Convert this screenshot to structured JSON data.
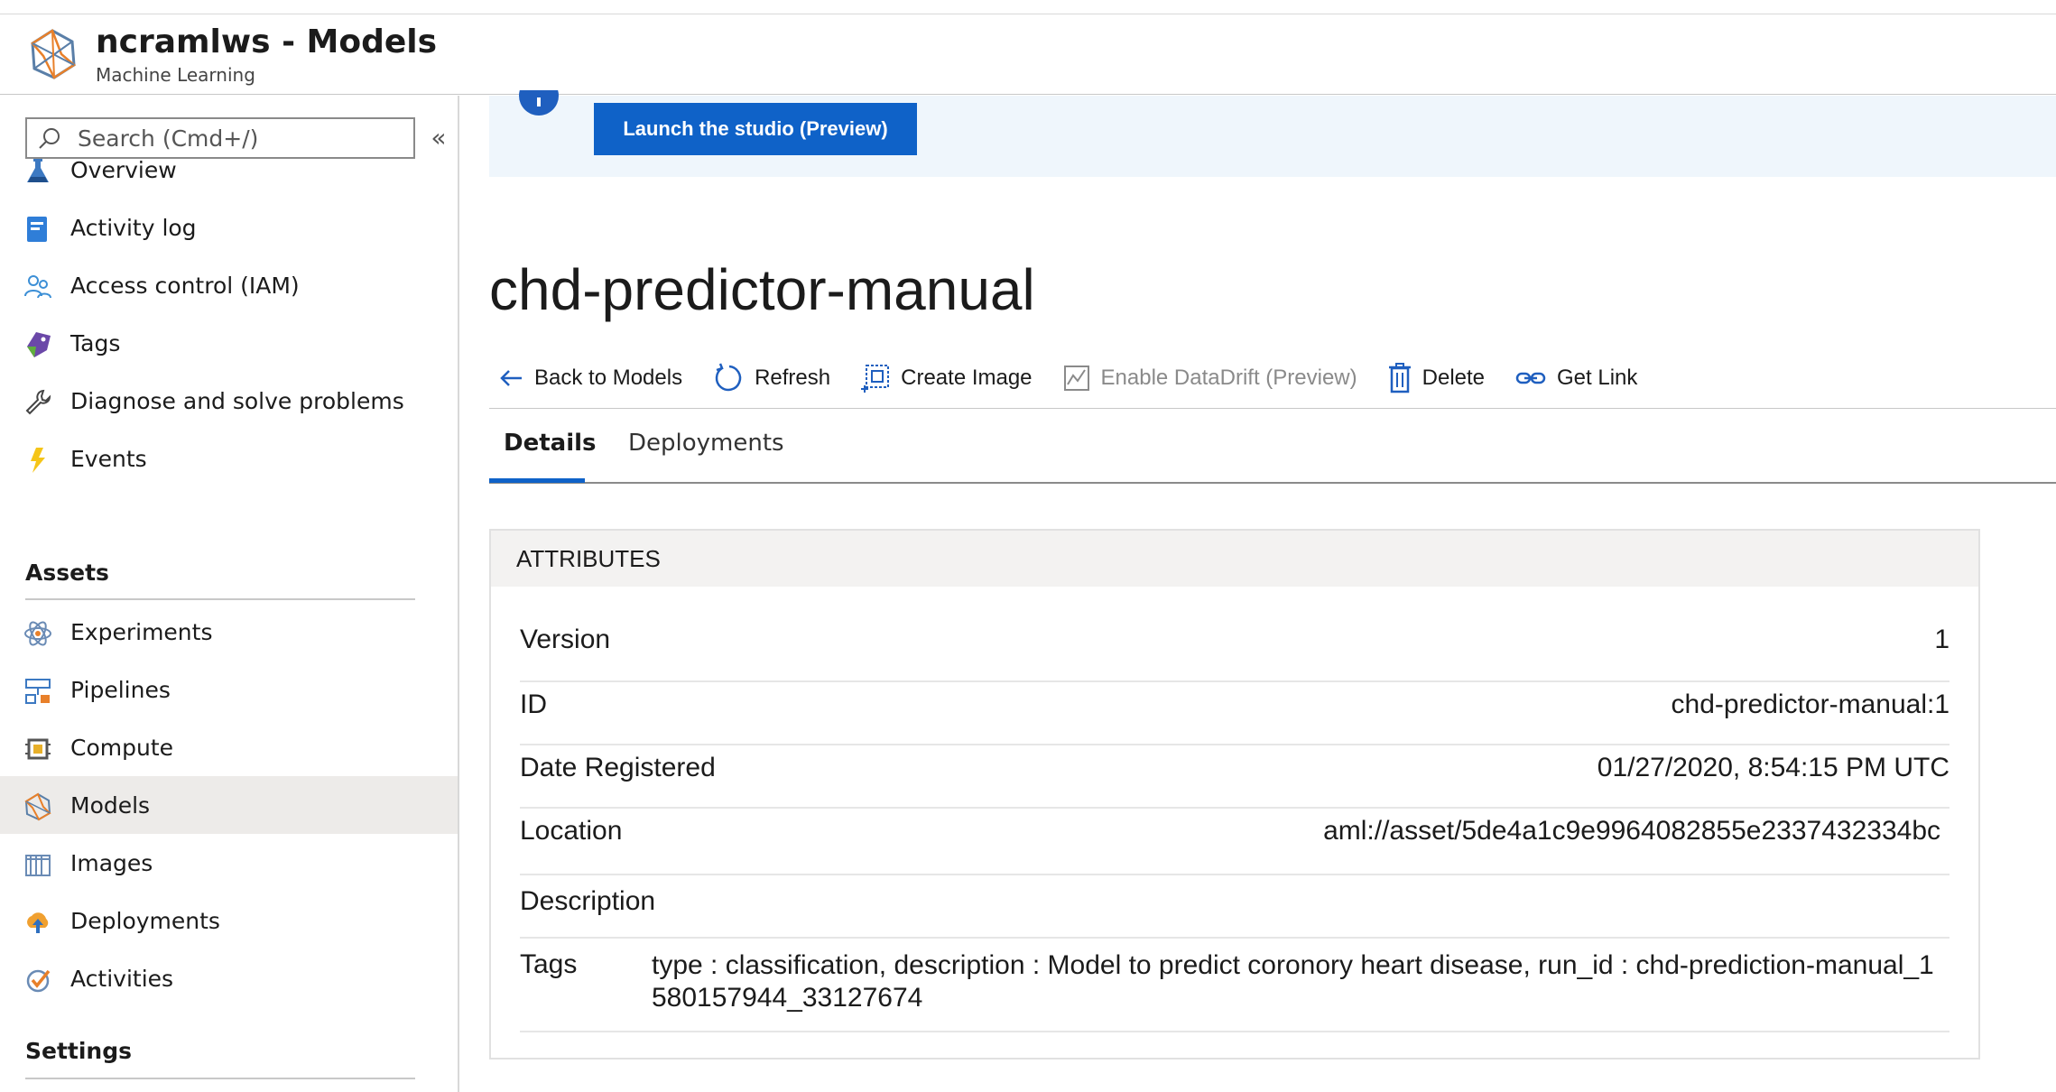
{
  "header": {
    "title": "ncramlws - Models",
    "subtitle": "Machine Learning"
  },
  "sidebar": {
    "search_placeholder": "Search (Cmd+/)",
    "collapse_glyph": "«",
    "items": [
      {
        "label": "Overview",
        "icon": "flask-icon"
      },
      {
        "label": "Activity log",
        "icon": "activity-log-icon"
      },
      {
        "label": "Access control (IAM)",
        "icon": "people-icon"
      },
      {
        "label": "Tags",
        "icon": "tag-icon"
      },
      {
        "label": "Diagnose and solve problems",
        "icon": "wrench-icon"
      },
      {
        "label": "Events",
        "icon": "lightning-icon"
      }
    ],
    "assets_title": "Assets",
    "assets": [
      {
        "label": "Experiments",
        "icon": "experiments-icon"
      },
      {
        "label": "Pipelines",
        "icon": "pipelines-icon"
      },
      {
        "label": "Compute",
        "icon": "compute-icon"
      },
      {
        "label": "Models",
        "icon": "models-icon",
        "active": true
      },
      {
        "label": "Images",
        "icon": "images-icon"
      },
      {
        "label": "Deployments",
        "icon": "deployments-icon"
      },
      {
        "label": "Activities",
        "icon": "activities-icon"
      }
    ],
    "settings_title": "Settings"
  },
  "banner": {
    "launch_label": "Launch the studio (Preview)"
  },
  "page": {
    "title": "chd-predictor-manual"
  },
  "toolbar": {
    "back_label": "Back to Models",
    "refresh_label": "Refresh",
    "create_image_label": "Create Image",
    "datadrift_label": "Enable DataDrift (Preview)",
    "delete_label": "Delete",
    "get_link_label": "Get Link"
  },
  "tabs": {
    "details": "Details",
    "deployments": "Deployments"
  },
  "attributes": {
    "heading": "ATTRIBUTES",
    "version_label": "Version",
    "version_value": "1",
    "id_label": "ID",
    "id_value": "chd-predictor-manual:1",
    "date_label": "Date Registered",
    "date_value": "01/27/2020, 8:54:15 PM UTC",
    "location_label": "Location",
    "location_value": "aml://asset/5de4a1c9e9964082855e2337432334bc",
    "description_label": "Description",
    "description_value": "",
    "tags_label": "Tags",
    "tags_value": "type : classification, description : Model to predict coronory heart disease, run_id : chd-prediction-manual_1580157944_33127674"
  },
  "colors": {
    "accent": "#0f62c8",
    "banner_bg": "#eff6fc",
    "active_nav_bg": "#edebe9"
  }
}
